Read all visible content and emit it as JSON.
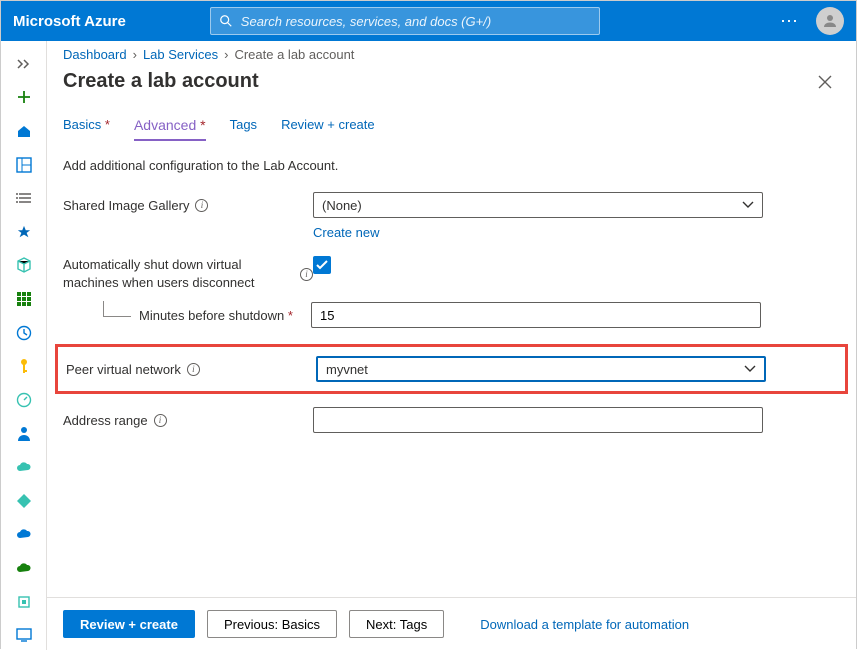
{
  "header": {
    "brand": "Microsoft Azure",
    "search_placeholder": "Search resources, services, and docs (G+/)"
  },
  "breadcrumb": {
    "items": [
      "Dashboard",
      "Lab Services"
    ],
    "current": "Create a lab account"
  },
  "page": {
    "title": "Create a lab account"
  },
  "tabs": {
    "basics": "Basics",
    "advanced": "Advanced",
    "tags": "Tags",
    "review": "Review + create"
  },
  "form": {
    "description": "Add additional configuration to the Lab Account.",
    "shared_image_gallery_label": "Shared Image Gallery",
    "shared_image_gallery_value": "(None)",
    "create_new": "Create new",
    "auto_shutdown_label": "Automatically shut down virtual machines when users disconnect",
    "auto_shutdown_checked": true,
    "minutes_label": "Minutes before shutdown",
    "minutes_value": "15",
    "peer_vnet_label": "Peer virtual network",
    "peer_vnet_value": "myvnet",
    "address_range_label": "Address range",
    "address_range_value": ""
  },
  "footer": {
    "review_create": "Review + create",
    "previous": "Previous: Basics",
    "next": "Next: Tags",
    "download_link": "Download a template for automation"
  }
}
